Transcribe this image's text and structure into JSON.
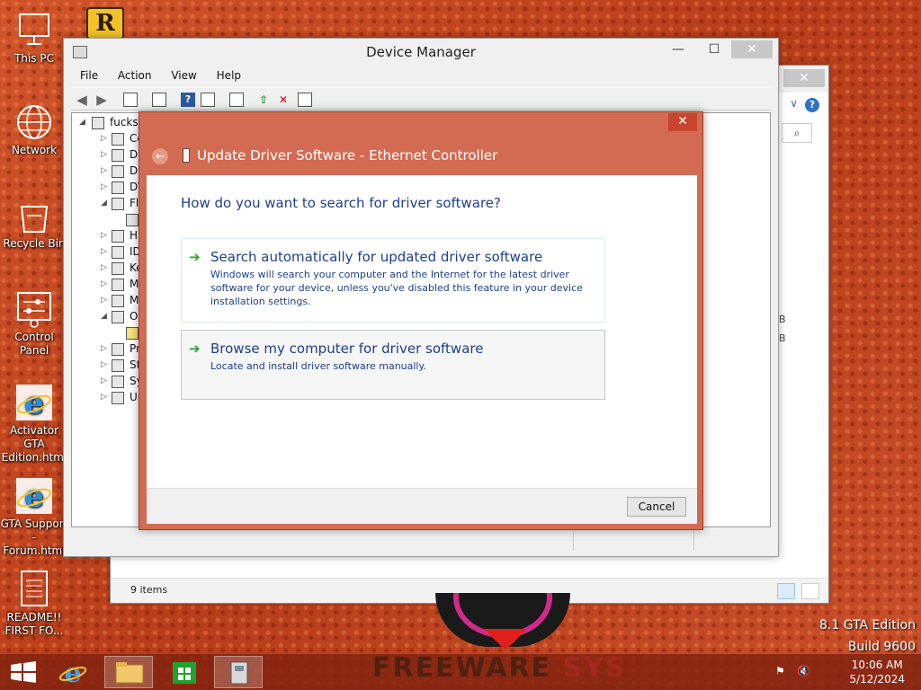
{
  "desktop": {
    "icons": [
      {
        "label": "This PC",
        "icon": "computer-icon"
      },
      {
        "label": "Network",
        "icon": "network-globe-icon"
      },
      {
        "label": "Recycle Bin",
        "icon": "recycle-bin-icon"
      },
      {
        "label": "Control Panel",
        "icon": "control-panel-icon"
      },
      {
        "label": "Activator GTA Edition.html",
        "icon": "internet-explorer-icon"
      },
      {
        "label": "GTA Support - Forum.html",
        "icon": "internet-explorer-icon"
      },
      {
        "label": "README!! FIRST FO...",
        "icon": "text-document-icon"
      }
    ],
    "rockstar_letter": "R"
  },
  "explorer": {
    "status_items": "9 items",
    "side_b_1": "B",
    "side_b_2": "B",
    "close": "✕",
    "help": "?",
    "chevron": "∨",
    "search": "⌕"
  },
  "device_manager": {
    "title": "Device Manager",
    "minimize": "—",
    "maximize": "☐",
    "close": "✕",
    "menu": [
      "File",
      "Action",
      "View",
      "Help"
    ],
    "tree": {
      "root": "fuckst",
      "items": [
        {
          "label": "Co",
          "expanded": false
        },
        {
          "label": "Di",
          "expanded": false
        },
        {
          "label": "Di",
          "expanded": false
        },
        {
          "label": "DV",
          "expanded": false
        },
        {
          "label": "Fl",
          "expanded": true
        },
        {
          "label": "",
          "expanded": false,
          "child": true
        },
        {
          "label": "Hu",
          "expanded": false
        },
        {
          "label": "ID",
          "expanded": false
        },
        {
          "label": "Ke",
          "expanded": false
        },
        {
          "label": "M",
          "expanded": false
        },
        {
          "label": "M",
          "expanded": false
        },
        {
          "label": "Ot",
          "expanded": true
        },
        {
          "label": "",
          "expanded": false,
          "child": true,
          "warning": true
        },
        {
          "label": "Pr",
          "expanded": false
        },
        {
          "label": "St",
          "expanded": false
        },
        {
          "label": "Sy",
          "expanded": false
        },
        {
          "label": "Ur",
          "expanded": false
        }
      ]
    }
  },
  "dialog": {
    "title": "Update Driver Software - Ethernet Controller",
    "close": "✕",
    "question": "How do you want to search for driver software?",
    "option_auto": {
      "title": "Search automatically for updated driver software",
      "desc": "Windows will search your computer and the Internet for the latest driver software for your device, unless you've disabled this feature in your device installation settings."
    },
    "option_browse": {
      "title": "Browse my computer for driver software",
      "desc": "Locate and install driver software manually."
    },
    "cancel": "Cancel",
    "arrow_glyph": "➔",
    "back_glyph": "←"
  },
  "watermark": {
    "line1": "8.1 GTA Edition",
    "line2": "Build 9600",
    "brand_a": "FREEWARE",
    "brand_b": "SYS"
  },
  "taskbar": {
    "time": "10:06 AM",
    "date": "5/12/2024",
    "apps": [
      "start-icon",
      "internet-explorer-icon",
      "file-explorer-icon",
      "store-icon",
      "device-manager-icon"
    ]
  },
  "colors": {
    "accent_dialog": "#d26b52",
    "link_blue": "#1e3f8c",
    "arrow_green": "#2aa12a"
  }
}
